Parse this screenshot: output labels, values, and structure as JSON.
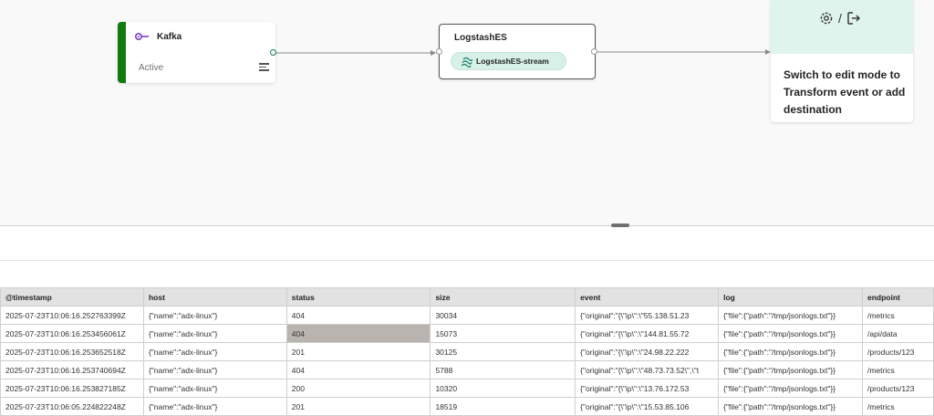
{
  "canvas": {
    "source": {
      "title": "Kafka",
      "status": "Active",
      "icon": "kafka-source-icon",
      "accent": "#107c10"
    },
    "stream": {
      "title": "LogstashES",
      "chip_label": "LogstashES-stream",
      "chip_icon": "stream-icon"
    },
    "destination": {
      "icons": [
        "transform-gear-icon",
        "exit-destination-icon"
      ],
      "separator": "/",
      "message": "Switch to edit mode to Transform event or add destination"
    }
  },
  "table": {
    "columns": [
      "@timestamp",
      "host",
      "status",
      "size",
      "event",
      "log",
      "endpoint"
    ],
    "rows": [
      [
        "2025-07-23T10:06:16.252763399Z",
        "{\"name\":\"adx-linux\"}",
        "404",
        "30034",
        "{\"original\":\"{\\\"ip\\\":\\\"55.138.51.23",
        "{\"file\":{\"path\":\"/tmp/jsonlogs.txt\"}}",
        "/metrics"
      ],
      [
        "2025-07-23T10:06:16.253456061Z",
        "{\"name\":\"adx-linux\"}",
        "404",
        "15073",
        "{\"original\":\"{\\\"ip\\\":\\\"144.81.55.72",
        "{\"file\":{\"path\":\"/tmp/jsonlogs.txt\"}}",
        "/api/data"
      ],
      [
        "2025-07-23T10:06:16.253652518Z",
        "{\"name\":\"adx-linux\"}",
        "201",
        "30125",
        "{\"original\":\"{\\\"ip\\\":\\\"24.98.22.222",
        "{\"file\":{\"path\":\"/tmp/jsonlogs.txt\"}}",
        "/products/123"
      ],
      [
        "2025-07-23T10:06:16.253740694Z",
        "{\"name\":\"adx-linux\"}",
        "404",
        "5788",
        "{\"original\":\"{\\\"ip\\\":\\\"48.73.73.52\\\",\\\"t",
        "{\"file\":{\"path\":\"/tmp/jsonlogs.txt\"}}",
        "/metrics"
      ],
      [
        "2025-07-23T10:06:16.253827185Z",
        "{\"name\":\"adx-linux\"}",
        "200",
        "10320",
        "{\"original\":\"{\\\"ip\\\":\\\"13.76.172.53",
        "{\"file\":{\"path\":\"/tmp/jsonlogs.txt\"}}",
        "/products/123"
      ],
      [
        "2025-07-23T10:06:05.224822248Z",
        "{\"name\":\"adx-linux\"}",
        "201",
        "18519",
        "{\"original\":\"{\\\"ip\\\":\\\"15.53.85.106",
        "{\"file\":{\"path\":\"/tmp/jsonlogs.txt\"}}",
        "/metrics"
      ]
    ],
    "selected_cell": {
      "row": 1,
      "col": 2
    }
  }
}
